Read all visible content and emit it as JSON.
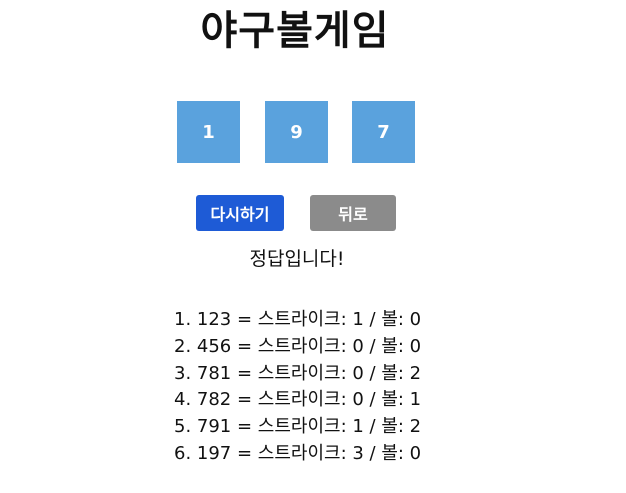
{
  "title": "야구볼게임",
  "digits": [
    "1",
    "9",
    "7"
  ],
  "buttons": {
    "retry_label": "다시하기",
    "back_label": "뒤로"
  },
  "colors": {
    "digit_box": "#5aa2dd",
    "retry_button": "#1e5bd6",
    "back_button": "#8b8b8b"
  },
  "message": "정답입니다!",
  "history": [
    "1. 123 = 스트라이크: 1 / 볼: 0",
    "2. 456 = 스트라이크: 0 / 볼: 0",
    "3. 781 = 스트라이크: 0 / 볼: 2",
    "4. 782 = 스트라이크: 0 / 볼: 1",
    "5. 791 = 스트라이크: 1 / 볼: 2",
    "6. 197 = 스트라이크: 3 / 볼: 0"
  ]
}
